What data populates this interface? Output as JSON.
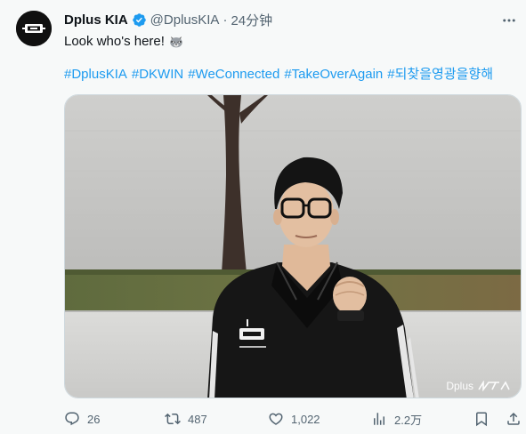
{
  "tweet": {
    "author_name": "Dplus KIA",
    "handle": "@DplusKIA",
    "separator": "·",
    "time": "24分钟",
    "text": "Look who's here!",
    "text_emoji_icon": "raccoon-icon",
    "hashtags": [
      "#DplusKIA",
      "#DKWIN",
      "#WeConnected",
      "#TakeOverAgain",
      "#되찾을영광을향해"
    ],
    "media_watermark": "Dplus",
    "verified_badge_color": "#1d9bf0",
    "accent_color": "#1d9bf0"
  },
  "actions": {
    "replies": "26",
    "reposts": "487",
    "likes": "1,022",
    "views": "2.2万"
  }
}
